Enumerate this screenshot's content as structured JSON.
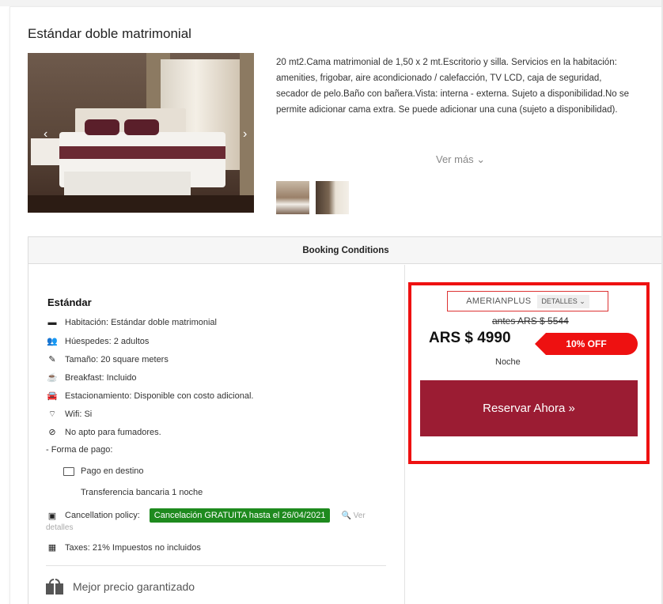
{
  "room": {
    "title": "Estándar doble matrimonial",
    "description": "20 mt2.Cama matrimonial de 1,50 x 2 mt.Escritorio y silla. Servicios en la habitación: amenities, frigobar, aire acondicionado / calefacción, TV LCD, caja de seguridad, secador de pelo.Baño con bañera.Vista: interna - externa. Sujeto a disponibilidad.No se permite adicionar cama extra. Se puede adicionar una cuna (sujeto a disponibilidad).",
    "ver_mas": "Ver más ⌄",
    "prev_arrow": "‹",
    "next_arrow": "›"
  },
  "booking": {
    "header": "Booking Conditions",
    "rate_name": "Estándar",
    "features": [
      {
        "icon": "bed-icon",
        "glyph": "▬",
        "text": "Habitación: Estándar doble matrimonial"
      },
      {
        "icon": "guests-icon",
        "glyph": "👥",
        "text": "Húespedes: 2 adultos"
      },
      {
        "icon": "ruler-icon",
        "glyph": "✎",
        "text": "Tamaño: 20 square meters"
      },
      {
        "icon": "coffee-icon",
        "glyph": "☕",
        "text": "Breakfast: Incluido"
      },
      {
        "icon": "car-icon",
        "glyph": "🚘",
        "text": "Estacionamiento: Disponible con costo adicional."
      },
      {
        "icon": "wifi-icon",
        "glyph": "⌔",
        "text": "Wifi: Si"
      },
      {
        "icon": "no-smoking-icon",
        "glyph": "⊘",
        "text": "No apto para fumadores."
      }
    ],
    "payment_label": "- Forma de pago:",
    "payment_on_site": "Pago en destino",
    "payment_transfer": "Transferencia bancaria 1 noche",
    "cancellation_label": "Cancellation policy:",
    "cancellation_badge": "Cancelación GRATUITA hasta el 26/04/2021",
    "ver_detalles_1": "🔍 Ver",
    "ver_detalles_2": "detalles",
    "taxes": "Taxes: 21% Impuestos no incluidos",
    "best_price": "Mejor precio garantizado"
  },
  "pricing": {
    "promo_code": "AMERIANPLUS",
    "detalles": "DETALLES ⌄",
    "antes": "antes ARS $ 5544",
    "price": "ARS $ 4990",
    "discount": "10% OFF",
    "per": "Noche",
    "cta": "Reservar Ahora »"
  },
  "colors": {
    "accent_red": "#ee1111",
    "cta_maroon": "#9b1c33",
    "badge_green": "#1e8a1e"
  }
}
